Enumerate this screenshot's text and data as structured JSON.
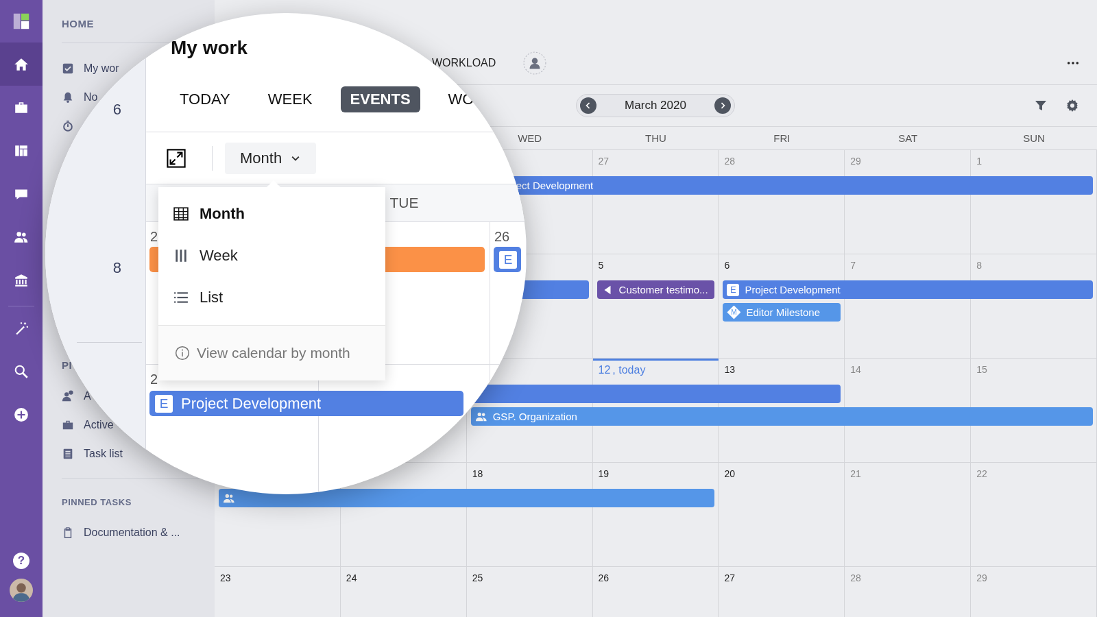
{
  "rail": {
    "items": [
      {
        "kind": "home",
        "selected": true
      },
      {
        "kind": "portfolio",
        "selected": false
      },
      {
        "kind": "boards",
        "selected": false
      },
      {
        "kind": "chat",
        "selected": false
      },
      {
        "kind": "team",
        "selected": false
      },
      {
        "kind": "admin",
        "selected": false
      }
    ],
    "tools": [
      {
        "kind": "magic"
      },
      {
        "kind": "search"
      },
      {
        "kind": "create"
      }
    ],
    "help": "?"
  },
  "nav": {
    "heading": "HOME",
    "items": [
      {
        "kind": "my_work",
        "label": "My wor"
      },
      {
        "kind": "notifications",
        "label": "No"
      },
      {
        "kind": "time"
      }
    ],
    "section_heading": "PI",
    "section_items": [
      {
        "kind": "assigned",
        "label": "A"
      },
      {
        "kind": "projects",
        "label": "Active"
      },
      {
        "kind": "tasks",
        "label": "Task list"
      }
    ],
    "pinned_heading": "PINNED TASKS",
    "pinned_items": [
      {
        "kind": "pinned",
        "label": "Documentation & ..."
      }
    ]
  },
  "header": {
    "tab": "WORKLOAD"
  },
  "toolbar": {
    "month": "March 2020"
  },
  "calendar": {
    "weekdays": {
      "wed": "WED",
      "thu": "THU",
      "fri": "FRI",
      "sat": "SAT",
      "sun": "SUN"
    },
    "weeks": [
      {
        "days": {
          "thu": {
            "date": "27",
            "muted": true
          },
          "fri": {
            "date": "28",
            "muted": true
          },
          "sat": {
            "date": "29",
            "muted": true
          },
          "sun": {
            "date": "1",
            "muted": true
          }
        },
        "events": [
          {
            "kind": "project",
            "label": "ect Development",
            "continued": true
          }
        ]
      },
      {
        "days": {
          "thu": {
            "date": "5",
            "muted": false
          },
          "fri": {
            "date": "6",
            "muted": false
          },
          "sat": {
            "date": "7",
            "muted": true
          },
          "sun": {
            "date": "8",
            "muted": true
          }
        },
        "events": [
          {
            "kind": "plain"
          },
          {
            "kind": "customer",
            "label": "Customer testimo..."
          },
          {
            "kind": "project",
            "badge": "E",
            "label": "Project Development"
          },
          {
            "kind": "milestone",
            "badge": "M",
            "label": "Editor Milestone"
          }
        ]
      },
      {
        "days": {
          "thu": {
            "date": "12",
            "muted": false,
            "today": true,
            "note": ", today"
          },
          "fri": {
            "date": "13",
            "muted": false
          },
          "sat": {
            "date": "14",
            "muted": true
          },
          "sun": {
            "date": "15",
            "muted": true
          }
        },
        "events": [
          {
            "kind": "plain"
          },
          {
            "kind": "organization",
            "label": "GSP. Organization"
          }
        ]
      },
      {
        "days": {
          "wed": {
            "date": "18",
            "muted": false
          },
          "thu": {
            "date": "19",
            "muted": false
          },
          "fri": {
            "date": "20",
            "muted": false
          },
          "sat": {
            "date": "21",
            "muted": true
          },
          "sun": {
            "date": "22",
            "muted": true
          }
        },
        "events": [
          {
            "kind": "organization"
          }
        ]
      },
      {
        "days": {
          "mon": {
            "date": "23",
            "muted": false
          },
          "tue": {
            "date": "24",
            "muted": false
          },
          "wed": {
            "date": "25",
            "muted": false
          },
          "thu": {
            "date": "26",
            "muted": false
          },
          "fri": {
            "date": "27",
            "muted": false
          },
          "sat": {
            "date": "28",
            "muted": true
          },
          "sun": {
            "date": "29",
            "muted": true
          }
        }
      }
    ]
  },
  "magnifier": {
    "counts": [
      "6",
      "8"
    ],
    "title": "My work",
    "tabs": [
      {
        "label": "TODAY",
        "selected": false
      },
      {
        "label": "WEEK",
        "selected": false
      },
      {
        "label": "EVENTS",
        "selected": true
      },
      {
        "label": "WO",
        "selected": false
      }
    ],
    "view_select": "Month",
    "weekdays": {
      "tue": "TUE"
    },
    "weeks": [
      {
        "days": {
          "mon": "2",
          "wed": "26"
        },
        "events": [
          {
            "kind": "task"
          },
          {
            "kind": "project",
            "badge": "E"
          }
        ]
      },
      {
        "days": {
          "mon": "2"
        },
        "events": [
          {
            "kind": "project",
            "badge": "E",
            "label": "Project Development"
          }
        ]
      }
    ],
    "menu": {
      "items": [
        {
          "kind": "month",
          "label": "Month",
          "selected": true
        },
        {
          "kind": "week",
          "label": "Week",
          "selected": false
        },
        {
          "kind": "list",
          "label": "List",
          "selected": false
        }
      ],
      "hint": "View calendar by month"
    }
  }
}
